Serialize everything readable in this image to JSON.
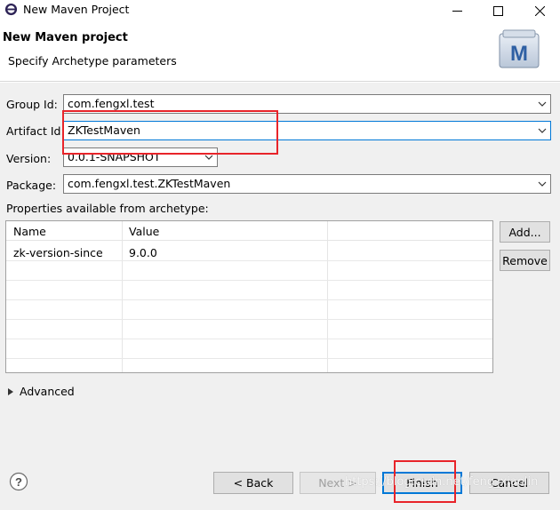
{
  "window": {
    "title": "New Maven Project"
  },
  "header": {
    "title": "New Maven project",
    "subtitle": "Specify Archetype parameters",
    "logo_letter": "M"
  },
  "form": {
    "group_id_label": "Group Id:",
    "group_id_value": "com.fengxl.test",
    "artifact_id_label": "Artifact Id:",
    "artifact_id_value": "ZKTestMaven",
    "version_label": "Version:",
    "version_value": "0.0.1-SNAPSHOT",
    "package_label": "Package:",
    "package_value": "com.fengxl.test.ZKTestMaven"
  },
  "properties": {
    "label": "Properties available from archetype:",
    "columns": [
      "Name",
      "Value"
    ],
    "rows": [
      {
        "name": "zk-version-since",
        "value": "9.0.0"
      }
    ],
    "add_label": "Add...",
    "remove_label": "Remove"
  },
  "advanced": {
    "label": "Advanced"
  },
  "footer": {
    "back_label": "< Back",
    "next_label": "Next >",
    "finish_label": "Finish",
    "cancel_label": "Cancel"
  },
  "watermark": "https://blog.csdn.net/feng_xiaolin",
  "colors": {
    "highlight": "#e8242a",
    "focus": "#0078d7",
    "dialog_bg": "#f0f0f0"
  }
}
